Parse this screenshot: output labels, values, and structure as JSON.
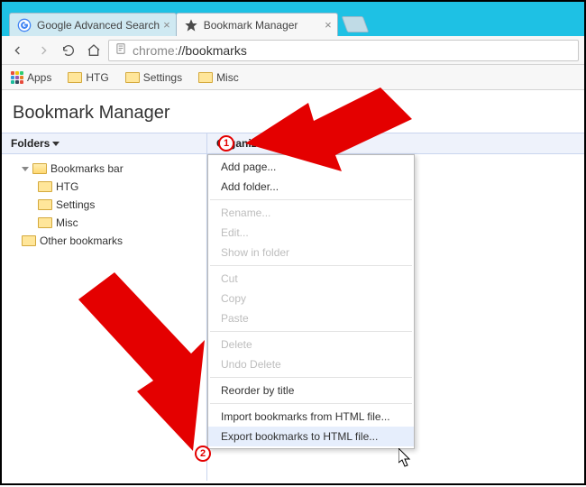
{
  "tabs": [
    {
      "title": "Google Advanced Search",
      "active": false
    },
    {
      "title": "Bookmark Manager",
      "active": true
    }
  ],
  "url_prefix": "chrome:",
  "url_path": "//bookmarks",
  "bookmark_bar": {
    "apps": "Apps",
    "items": [
      "HTG",
      "Settings",
      "Misc"
    ]
  },
  "page_title": "Bookmark Manager",
  "columns": {
    "folders": "Folders",
    "organize": "Organize"
  },
  "tree": {
    "root": "Bookmarks bar",
    "children": [
      "HTG",
      "Settings",
      "Misc"
    ],
    "other": "Other bookmarks"
  },
  "organize_menu": {
    "add_page": "Add page...",
    "add_folder": "Add folder...",
    "rename": "Rename...",
    "edit": "Edit...",
    "show_in_folder": "Show in folder",
    "cut": "Cut",
    "copy": "Copy",
    "paste": "Paste",
    "delete": "Delete",
    "undo_delete": "Undo Delete",
    "reorder": "Reorder by title",
    "import": "Import bookmarks from HTML file...",
    "export": "Export bookmarks to HTML file..."
  },
  "annotations": {
    "step1": "1",
    "step2": "2"
  }
}
